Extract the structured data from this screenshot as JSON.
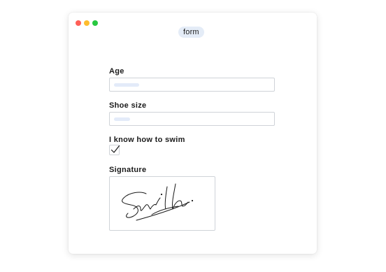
{
  "window": {
    "title": "form",
    "controls": {
      "close_color": "#ff5f57",
      "minimize_color": "#febc2e",
      "maximize_color": "#28c840"
    }
  },
  "form": {
    "age": {
      "label": "Age",
      "value": ""
    },
    "shoe_size": {
      "label": "Shoe size",
      "value": ""
    },
    "swim": {
      "label": "I know how to swim",
      "checked": true
    },
    "signature": {
      "label": "Signature",
      "signed": true
    }
  },
  "colors": {
    "pill_background": "#e4ecf7",
    "placeholder_bar": "#e3ebf9",
    "border": "#cfd3d8",
    "ink": "#1a1a1a"
  }
}
